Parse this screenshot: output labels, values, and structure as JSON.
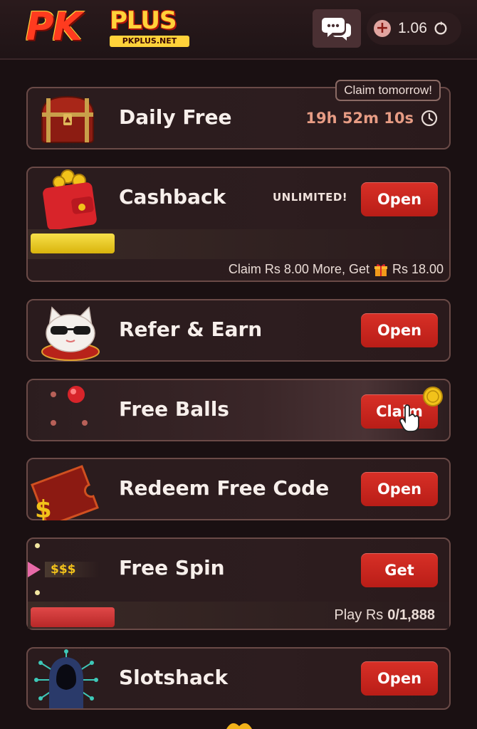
{
  "header": {
    "logo_main": "PK",
    "logo_plus": "PLUS",
    "logo_site": "PKPLUS.NET",
    "balance": "1.06"
  },
  "cards": {
    "daily_free": {
      "title": "Daily Free",
      "tag": "Claim tomorrow!",
      "timer": "19h 52m 10s"
    },
    "cashback": {
      "title": "Cashback",
      "badge": "UNLIMITED!",
      "button": "Open",
      "note_prefix": "Claim Rs 8.00 More, Get",
      "note_suffix": "Rs 18.00",
      "progress": 0.2
    },
    "refer": {
      "title": "Refer & Earn",
      "button": "Open"
    },
    "free_balls": {
      "title": "Free Balls",
      "button": "Claim"
    },
    "redeem": {
      "title": "Redeem Free Code",
      "button": "Open"
    },
    "free_spin": {
      "title": "Free Spin",
      "label": "$$$",
      "button": "Get",
      "note_prefix": "Play Rs",
      "note_value": "0/1,888",
      "progress": 0.2
    },
    "slotshack": {
      "title": "Slotshack",
      "button": "Open"
    }
  },
  "colors": {
    "accent_red": "#c8241c",
    "gold": "#f2c21a",
    "timer": "#e79c84",
    "background": "#1a1012"
  }
}
